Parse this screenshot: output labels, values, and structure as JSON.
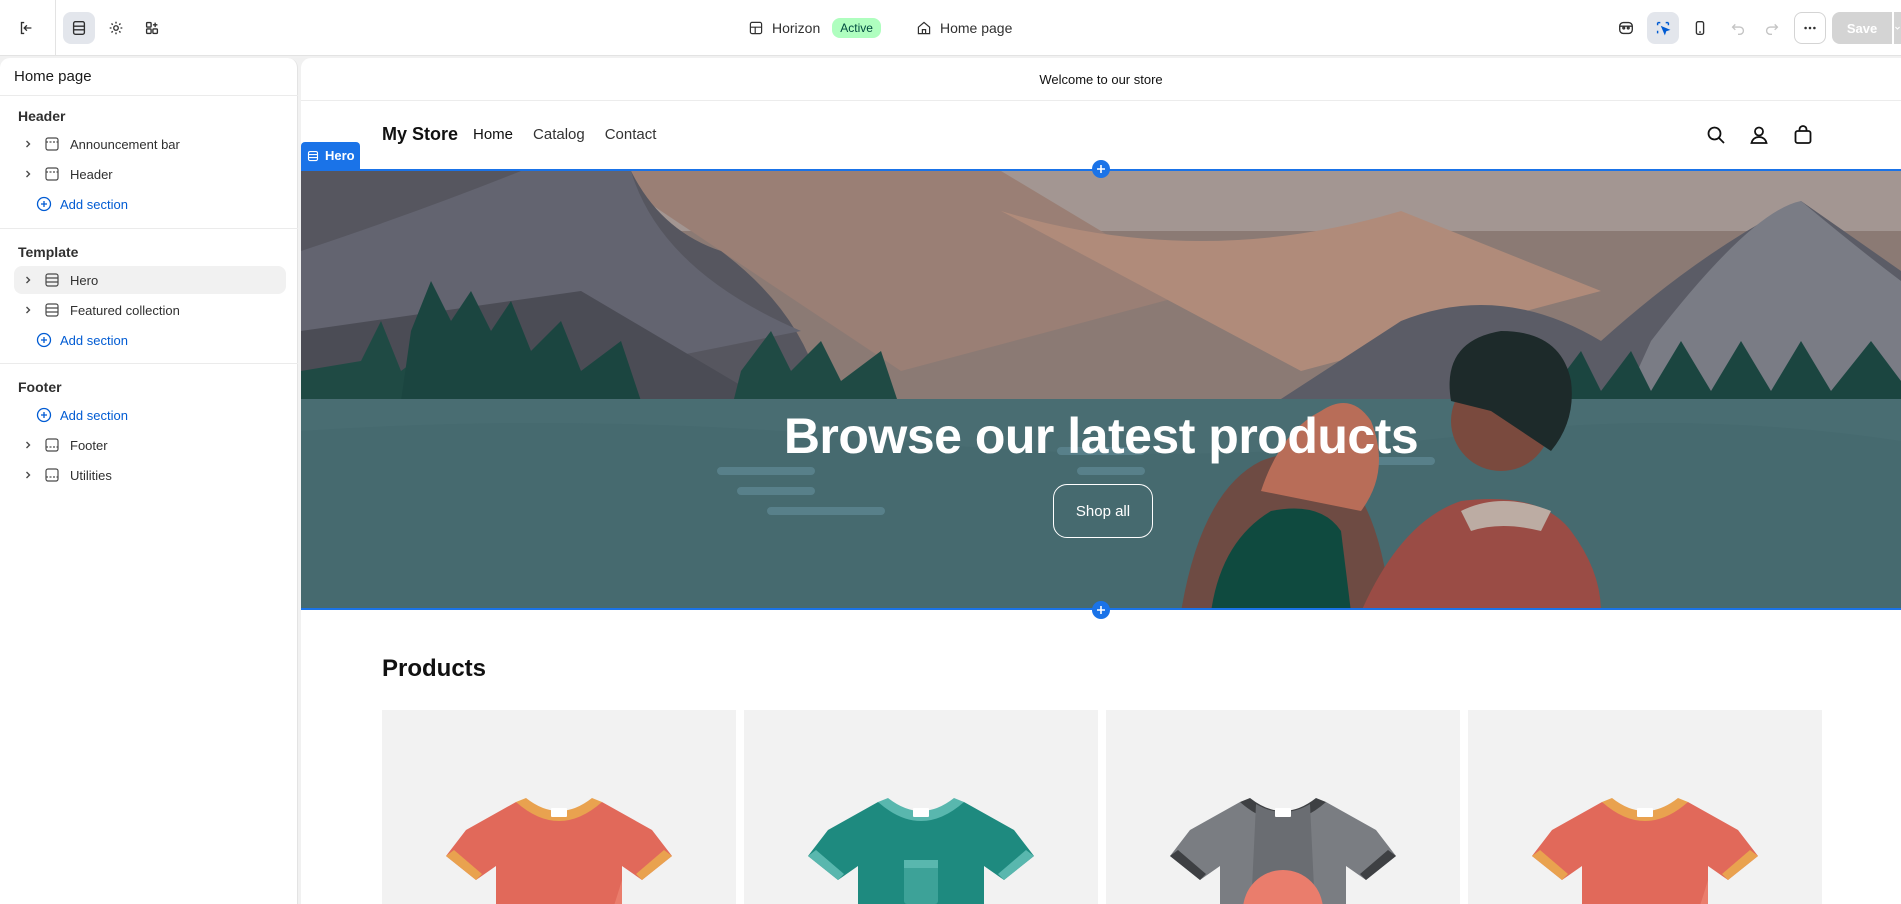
{
  "topbar": {
    "theme_name": "Horizon",
    "theme_status": "Active",
    "page_name": "Home page",
    "save_label": "Save"
  },
  "sidebar": {
    "title": "Home page",
    "groups": [
      {
        "title": "Header",
        "items": [
          "Announcement bar",
          "Header"
        ],
        "add_label": "Add section"
      },
      {
        "title": "Template",
        "items": [
          "Hero",
          "Featured collection"
        ],
        "add_label": "Add section"
      },
      {
        "title": "Footer",
        "add_label": "Add section",
        "items": [
          "Footer",
          "Utilities"
        ]
      }
    ]
  },
  "preview": {
    "announcement": "Welcome to our store",
    "store_name": "My Store",
    "nav": [
      "Home",
      "Catalog",
      "Contact"
    ],
    "hero_tag": "Hero",
    "hero_title": "Browse our latest products",
    "hero_button": "Shop all",
    "products_title": "Products"
  },
  "colors": {
    "accent": "#1a73e8",
    "link": "#005bd3",
    "active_badge": "#affebf"
  }
}
